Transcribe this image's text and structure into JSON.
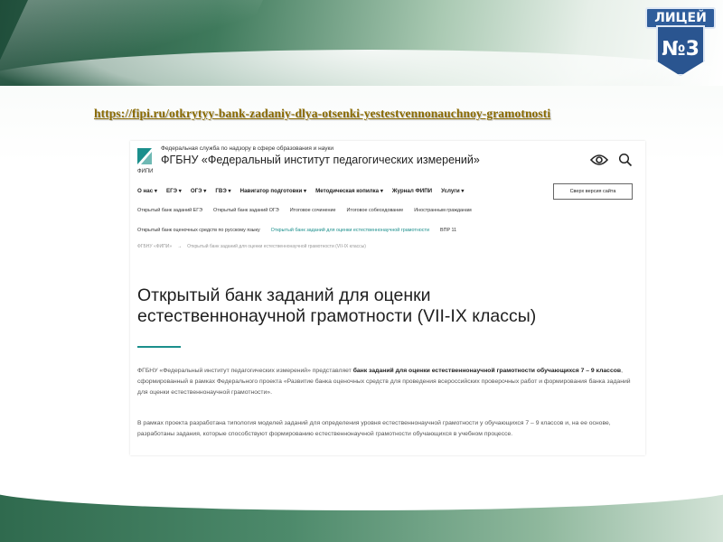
{
  "slide": {
    "url": "https://fipi.ru/otkrytyy-bank-zadaniy-dlya-otsenki-yestestvennonauchnoy-gramotnosti",
    "badge_top": "ЛИЦЕЙ",
    "badge_bottom": "№3"
  },
  "site": {
    "org_small": "Федеральная служба по надзору в сфере образования и науки",
    "org_big": "ФГБНУ «Федеральный институт педагогических измерений»",
    "fipi": "ФИПИ",
    "icons": [
      "eye-icon",
      "search-icon"
    ],
    "accent_color": "#1b8f8c"
  },
  "nav": {
    "items": [
      "О нас ▾",
      "ЕГЭ ▾",
      "ОГЭ ▾",
      "ГВЭ ▾",
      "Навигатор подготовки ▾",
      "Методическая копилка ▾",
      "Журнал ФИПИ",
      "Услуги ▾"
    ],
    "sight_button": "Сверх версия сайта"
  },
  "subnav": {
    "row1": [
      "Открытый банк заданий ЕГЭ",
      "Открытый банк заданий ОГЭ",
      "Итоговое сочинение",
      "Итоговое собеседование",
      "Иностранным гражданам"
    ],
    "row2": [
      "Открытый банк оценочных средств по русскому языку",
      "Открытый банк заданий для оценки естественнонаучной грамотности",
      "ВПР 11"
    ]
  },
  "breadcrumb": {
    "home": "ФГБНУ «ФИПИ»",
    "arrow": "→",
    "current": "Открытый банк заданий для оценки естественнонаучной грамотности (VII-IX классы)"
  },
  "content": {
    "title_line1": "Открытый банк заданий для оценки",
    "title_line2": "естественнонаучной грамотности (VII-IX классы)",
    "p1_a": "ФГБНУ «Федеральный институт педагогических измерений» представляет ",
    "p1_b": "банк заданий для оценки естественнонаучной грамотности обучающихся 7 – 9 классов",
    "p1_c": ", сформированный в рамках Федерального проекта «Развитие банка оценочных средств для проведения всероссийских проверочных работ и формирования банка заданий для оценки естественнонаучной грамотности».",
    "p2": "В рамках проекта разработана типология моделей заданий для определения уровня естественнонаучной грамотности у обучающихся 7 – 9 классов и, на ее основе, разработаны задания, которые способствуют формированию естественнонаучной грамотности обучающихся в учебном процессе."
  }
}
